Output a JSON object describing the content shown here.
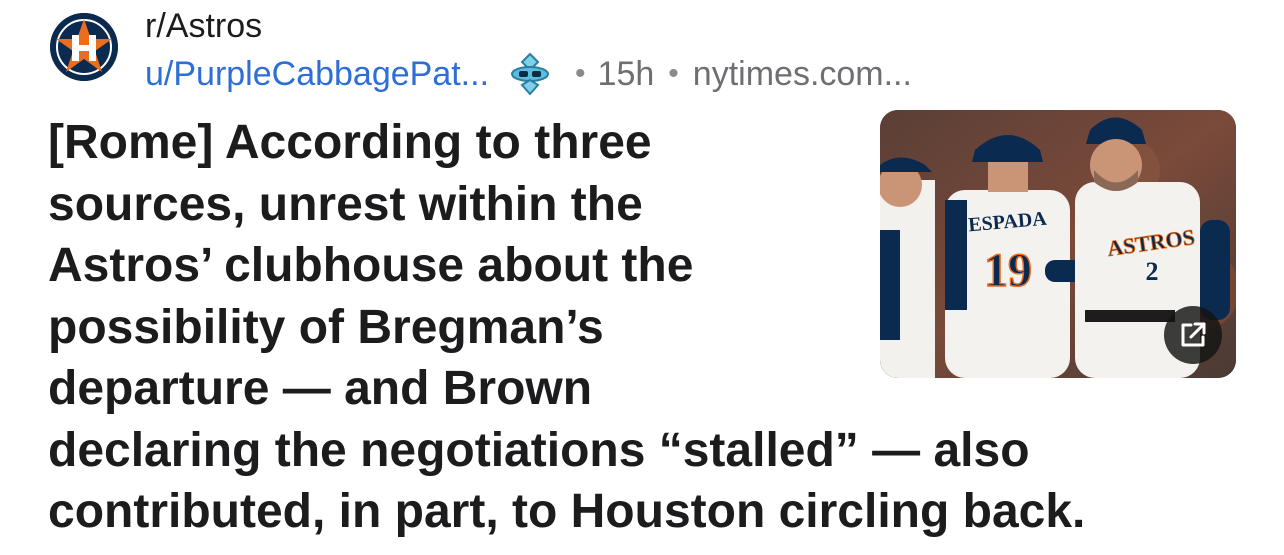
{
  "post": {
    "subreddit": "r/Astros",
    "username": "u/PurpleCabbagePat...",
    "time": "15h",
    "domain": "nytimes.com...",
    "title_lines": [
      "[Rome] According to three",
      "sources, unrest within the",
      "Astros’ clubhouse about the",
      "possibility of Bregman’s",
      "departure — and Brown",
      "declaring the negotiations “stalled” — also",
      "contributed, in part, to Houston circling back."
    ],
    "meta_separator": "•"
  },
  "thumbnail": {
    "jersey_names": [
      "ESPADA",
      "ASTROS"
    ],
    "jersey_numbers": [
      "19",
      "2"
    ]
  },
  "icons": {
    "avatar": "astros-logo-icon",
    "user_badge": "avatar-badge-icon",
    "open_link": "external-link-icon"
  },
  "colors": {
    "username": "#2d6fd6",
    "astros_navy": "#0b2a4f",
    "astros_orange": "#eb6e1f"
  }
}
